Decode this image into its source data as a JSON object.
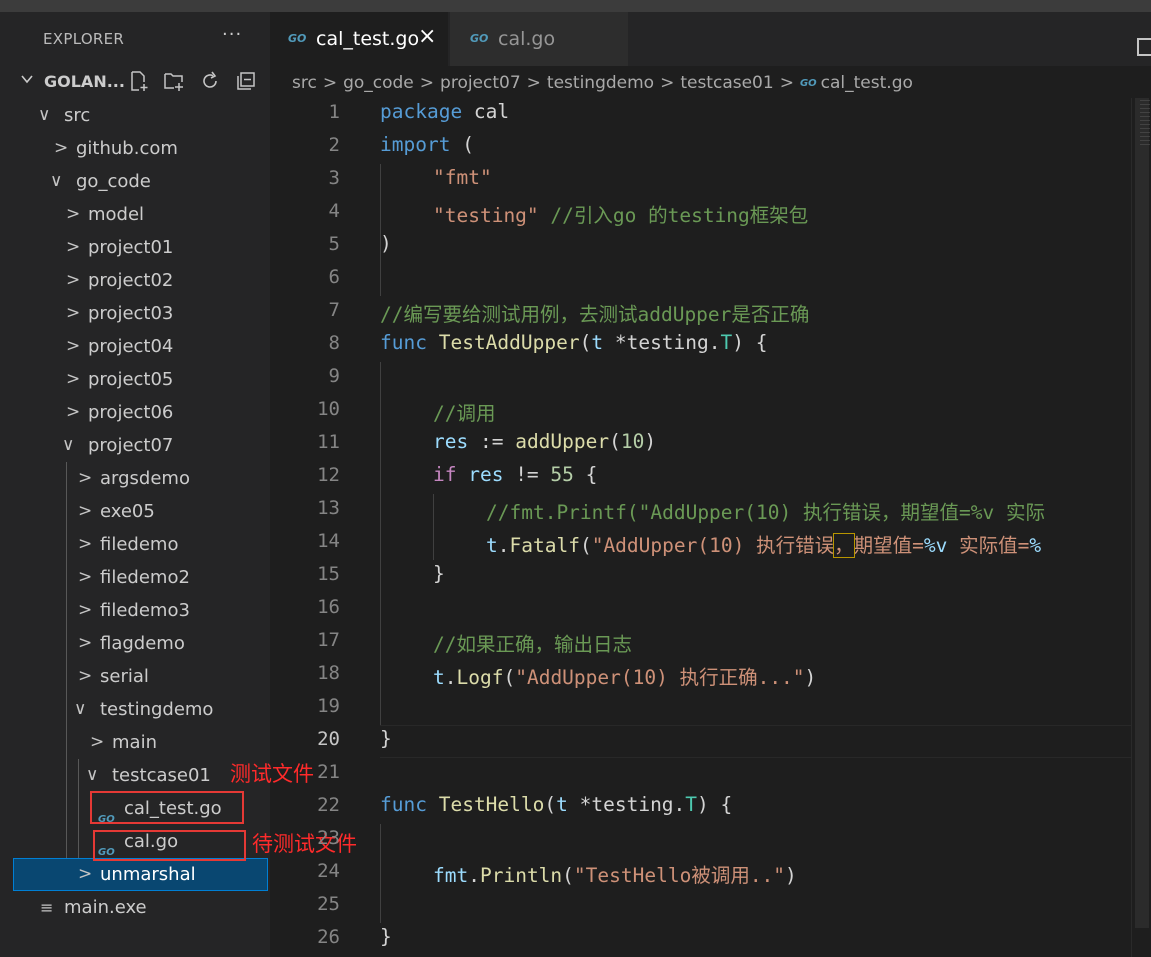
{
  "sidebar": {
    "title": "EXPLORER",
    "more_label": "···",
    "workspace": "GOLAN...",
    "tree": [
      {
        "label": "src",
        "type": "folder",
        "expanded": true
      },
      {
        "label": "github.com",
        "type": "folder",
        "expanded": false
      },
      {
        "label": "go_code",
        "type": "folder",
        "expanded": true
      },
      {
        "label": "model",
        "type": "folder",
        "expanded": false
      },
      {
        "label": "project01",
        "type": "folder",
        "expanded": false
      },
      {
        "label": "project02",
        "type": "folder",
        "expanded": false
      },
      {
        "label": "project03",
        "type": "folder",
        "expanded": false
      },
      {
        "label": "project04",
        "type": "folder",
        "expanded": false
      },
      {
        "label": "project05",
        "type": "folder",
        "expanded": false
      },
      {
        "label": "project06",
        "type": "folder",
        "expanded": false
      },
      {
        "label": "project07",
        "type": "folder",
        "expanded": true
      },
      {
        "label": "argsdemo",
        "type": "folder",
        "expanded": false
      },
      {
        "label": "exe05",
        "type": "folder",
        "expanded": false
      },
      {
        "label": "filedemo",
        "type": "folder",
        "expanded": false
      },
      {
        "label": "filedemo2",
        "type": "folder",
        "expanded": false
      },
      {
        "label": "filedemo3",
        "type": "folder",
        "expanded": false
      },
      {
        "label": "flagdemo",
        "type": "folder",
        "expanded": false
      },
      {
        "label": "serial",
        "type": "folder",
        "expanded": false
      },
      {
        "label": "testingdemo",
        "type": "folder",
        "expanded": true
      },
      {
        "label": "main",
        "type": "folder",
        "expanded": false
      },
      {
        "label": "testcase01",
        "type": "folder",
        "expanded": true
      },
      {
        "label": "cal_test.go",
        "type": "go-file",
        "icon": "GO"
      },
      {
        "label": "cal.go",
        "type": "go-file",
        "icon": "GO"
      },
      {
        "label": "unmarshal",
        "type": "folder",
        "expanded": false,
        "selected": true
      },
      {
        "label": "main.exe",
        "type": "file"
      }
    ]
  },
  "annotations": {
    "test_file": "测试文件",
    "file_under_test": "待测试文件"
  },
  "tabs": [
    {
      "label": "cal_test.go",
      "icon": "GO",
      "active": true,
      "close": "×"
    },
    {
      "label": "cal.go",
      "icon": "GO",
      "active": false
    }
  ],
  "breadcrumb": {
    "items": [
      "src",
      "go_code",
      "project07",
      "testingdemo",
      "testcase01"
    ],
    "file": "cal_test.go",
    "file_icon": "GO",
    "separator": ">"
  },
  "editor": {
    "line_numbers": [
      "1",
      "2",
      "3",
      "4",
      "5",
      "6",
      "7",
      "8",
      "9",
      "10",
      "11",
      "12",
      "13",
      "14",
      "15",
      "16",
      "17",
      "18",
      "19",
      "20",
      "21",
      "22",
      "23",
      "24",
      "25",
      "26"
    ],
    "current_line": "20",
    "code": {
      "l1_kw": "package",
      "l1_rest": " cal",
      "l2_kw": "import",
      "l2_rest": " (",
      "l3_str": "\"fmt\"",
      "l4_str": "\"testing\"",
      "l4_cm": " //引入go 的testing框架包",
      "l5": ")",
      "l7_cm": "//编写要给测试用例，去测试addUpper是否正确",
      "l8_kw": "func",
      "l8_fn": "TestAddUpper",
      "l8_p1": "(",
      "l8_var": "t",
      "l8_p2": " *testing.",
      "l8_ty": "T",
      "l8_p3": ") {",
      "l10_cm": "//调用",
      "l11_var": "res",
      "l11_op": " := ",
      "l11_fn": "addUpper",
      "l11_p1": "(",
      "l11_num": "10",
      "l11_p2": ")",
      "l12_kw": "if",
      "l12_var": " res",
      "l12_op": " != ",
      "l12_num": "55",
      "l12_p": " {",
      "l13_cm": "//fmt.Printf(\"AddUpper(10) 执行错误，期望值=%v 实际",
      "l14_var": "t",
      "l14_dot": ".",
      "l14_fn": "Fatalf",
      "l14_p": "(",
      "l14_s1": "\"AddUpper(10) 执行错误",
      "l14_comma": "，",
      "l14_s2": "期望值=",
      "l14_f1": "%v",
      "l14_s3": " 实际值=",
      "l14_f2": "%",
      "l15": "}",
      "l17_cm": "//如果正确，输出日志",
      "l18_var": "t",
      "l18_dot": ".",
      "l18_fn": "Logf",
      "l18_p1": "(",
      "l18_str": "\"AddUpper(10) 执行正确...\"",
      "l18_p2": ")",
      "l20": "}",
      "l22_kw": "func",
      "l22_fn": "TestHello",
      "l22_p1": "(",
      "l22_var": "t",
      "l22_p2": " *testing.",
      "l22_ty": "T",
      "l22_p3": ") {",
      "l24_var": "fmt",
      "l24_dot": ".",
      "l24_fn": "Println",
      "l24_p1": "(",
      "l24_str": "\"TestHello被调用..\"",
      "l24_p2": ")",
      "l26": "}"
    }
  }
}
